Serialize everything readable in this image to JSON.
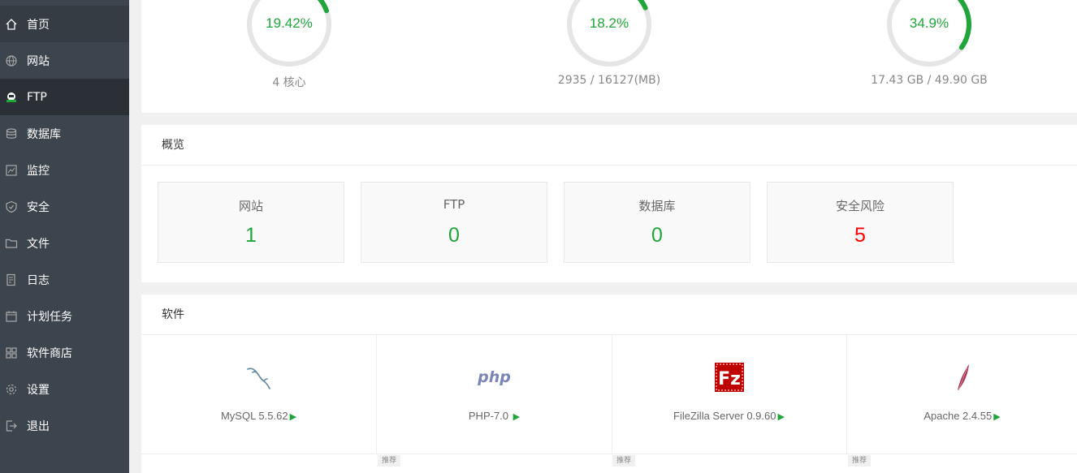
{
  "sidebar": {
    "items": [
      {
        "label": "首页",
        "icon": "home-icon"
      },
      {
        "label": "网站",
        "icon": "globe-icon"
      },
      {
        "label": "FTP",
        "icon": "ftp-icon"
      },
      {
        "label": "数据库",
        "icon": "database-icon"
      },
      {
        "label": "监控",
        "icon": "monitor-icon"
      },
      {
        "label": "安全",
        "icon": "shield-icon"
      },
      {
        "label": "文件",
        "icon": "folder-icon"
      },
      {
        "label": "日志",
        "icon": "log-icon"
      },
      {
        "label": "计划任务",
        "icon": "calendar-icon"
      },
      {
        "label": "软件商店",
        "icon": "grid-icon"
      },
      {
        "label": "设置",
        "icon": "gear-icon"
      },
      {
        "label": "退出",
        "icon": "logout-icon"
      }
    ],
    "active": "FTP"
  },
  "status": {
    "gauges": [
      {
        "value": "19.42%",
        "percent": 19.42,
        "caption": "4 核心"
      },
      {
        "value": "18.2%",
        "percent": 18.2,
        "caption": "2935 / 16127(MB)"
      },
      {
        "value": "34.9%",
        "percent": 34.9,
        "caption": "17.43 GB / 49.90 GB"
      }
    ],
    "accent_color": "#20a53a"
  },
  "overview": {
    "title": "概览",
    "cards": [
      {
        "label": "网站",
        "value": "1"
      },
      {
        "label": "FTP",
        "value": "0"
      },
      {
        "label": "数据库",
        "value": "0"
      },
      {
        "label": "安全风险",
        "value": "5"
      }
    ],
    "danger_color": "#ff0000"
  },
  "software": {
    "title": "软件",
    "items": [
      {
        "name": "MySQL 5.5.62",
        "icon": "mysql-icon"
      },
      {
        "name": "PHP-7.0 ",
        "icon": "php-icon"
      },
      {
        "name": "FileZilla Server 0.9.60",
        "icon": "filezilla-icon"
      },
      {
        "name": "Apache 2.4.55",
        "icon": "apache-feather-icon"
      }
    ],
    "play_glyph": "▶",
    "tags": [
      "推荐",
      "推荐",
      "推荐"
    ]
  }
}
